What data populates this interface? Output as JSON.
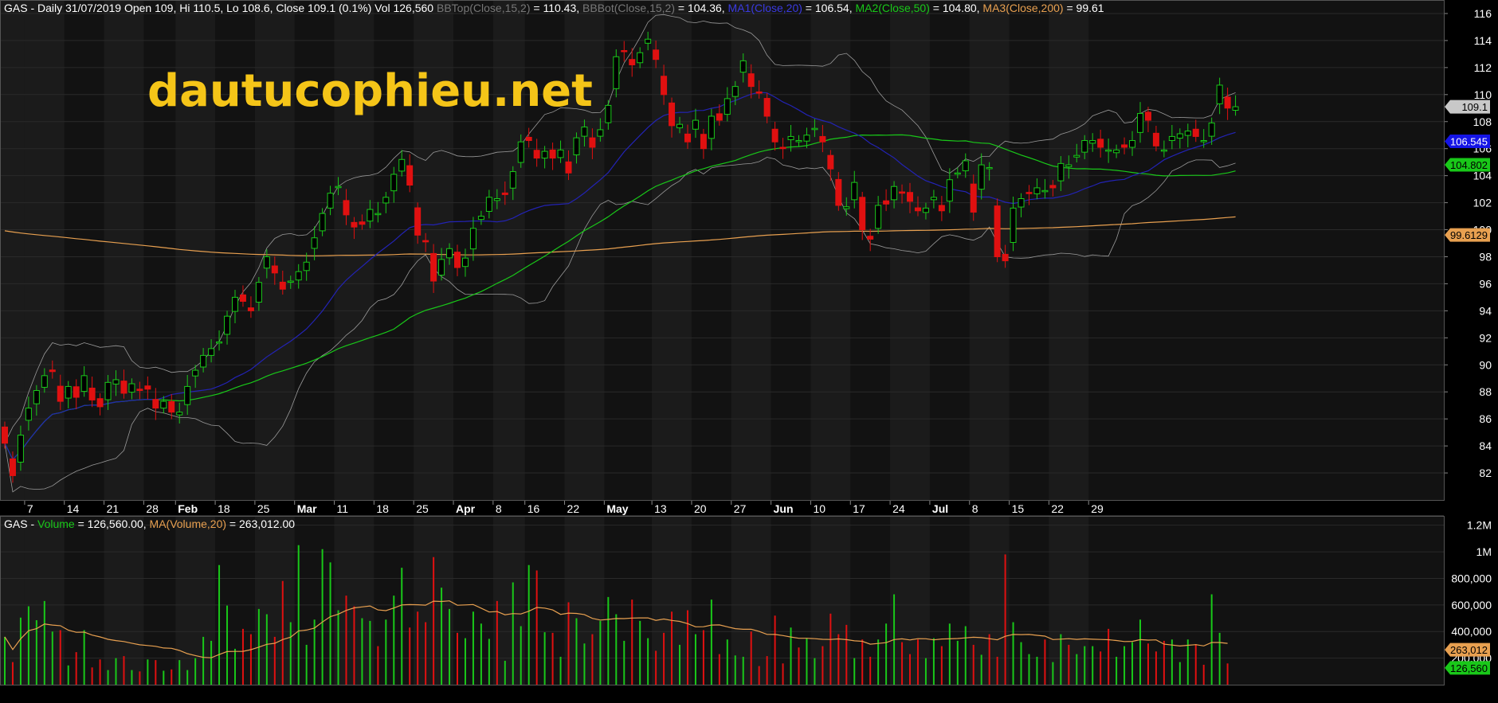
{
  "watermark": "dautucophieu.net",
  "colors": {
    "background": "#000000",
    "panel_even": "#1b1b1b",
    "panel_odd": "#121212",
    "grid": "#2a2a2a",
    "up": "#19c819",
    "down": "#e01010",
    "bb": "#9a9a9a",
    "ma20": "#2323b4",
    "ma50": "#19c819",
    "ma200": "#e8a050",
    "volma": "#e8a050",
    "text": "#ffffff",
    "label_gray": "#777777"
  },
  "price_legend": [
    {
      "text": "GAS - Daily 31/07/2019 Open 109, Hi 110.5, Lo 108.6, Close 109.1 (0.1%) Vol 126,560 ",
      "color": "#ffffff"
    },
    {
      "text": "BBTop(Close,15,2)",
      "color": "#777777"
    },
    {
      "text": " = 110.43, ",
      "color": "#ffffff"
    },
    {
      "text": "BBBot(Close,15,2)",
      "color": "#777777"
    },
    {
      "text": " = 104.36, ",
      "color": "#ffffff"
    },
    {
      "text": "MA1(Close,20)",
      "color": "#3a3ae0"
    },
    {
      "text": " = 106.54, ",
      "color": "#ffffff"
    },
    {
      "text": "MA2(Close,50)",
      "color": "#19c819"
    },
    {
      "text": " = 104.80, ",
      "color": "#ffffff"
    },
    {
      "text": "MA3(Close,200)",
      "color": "#e8a050"
    },
    {
      "text": " = 99.61",
      "color": "#ffffff"
    }
  ],
  "volume_legend": [
    {
      "text": "GAS - ",
      "color": "#ffffff"
    },
    {
      "text": "Volume",
      "color": "#19c819"
    },
    {
      "text": " = 126,560.00, ",
      "color": "#ffffff"
    },
    {
      "text": "MA(Volume,20)",
      "color": "#e8a050"
    },
    {
      "text": " = 263,012.00",
      "color": "#ffffff"
    }
  ],
  "price_tags": [
    {
      "text": "109.1",
      "value": 109.1,
      "bg": "#c8c8c8",
      "fg": "#000000"
    },
    {
      "text": "106.545",
      "value": 106.545,
      "bg": "#1414e6",
      "fg": "#ffffff"
    },
    {
      "text": "104.802",
      "value": 104.802,
      "bg": "#19c819",
      "fg": "#000000"
    },
    {
      "text": "99.6129",
      "value": 99.6129,
      "bg": "#e8a050",
      "fg": "#000000"
    }
  ],
  "volume_tags": [
    {
      "text": "263,012",
      "value": 263012,
      "bg": "#e8a050",
      "fg": "#000000"
    },
    {
      "text": "126,560",
      "value": 126560,
      "bg": "#19c819",
      "fg": "#000000"
    }
  ],
  "chart_data": [
    {
      "type": "candlestick",
      "title": "GAS - Daily 31/07/2019",
      "ylim": [
        80,
        117
      ],
      "yticks": [
        82,
        84,
        86,
        88,
        90,
        92,
        94,
        96,
        98,
        100,
        102,
        104,
        106,
        108,
        110,
        112,
        114,
        116
      ],
      "grid": true,
      "x_labels": [
        {
          "i": 3,
          "text": "7",
          "month": false
        },
        {
          "i": 8,
          "text": "14",
          "month": false
        },
        {
          "i": 13,
          "text": "21",
          "month": false
        },
        {
          "i": 18,
          "text": "28",
          "month": false
        },
        {
          "i": 22,
          "text": "Feb",
          "month": true
        },
        {
          "i": 27,
          "text": "18",
          "month": false
        },
        {
          "i": 32,
          "text": "25",
          "month": false
        },
        {
          "i": 37,
          "text": "Mar",
          "month": true
        },
        {
          "i": 42,
          "text": "11",
          "month": false
        },
        {
          "i": 47,
          "text": "18",
          "month": false
        },
        {
          "i": 52,
          "text": "25",
          "month": false
        },
        {
          "i": 57,
          "text": "Apr",
          "month": true
        },
        {
          "i": 62,
          "text": "8",
          "month": false
        },
        {
          "i": 66,
          "text": "16",
          "month": false
        },
        {
          "i": 71,
          "text": "22",
          "month": false
        },
        {
          "i": 76,
          "text": "May",
          "month": true
        },
        {
          "i": 82,
          "text": "13",
          "month": false
        },
        {
          "i": 87,
          "text": "20",
          "month": false
        },
        {
          "i": 92,
          "text": "27",
          "month": false
        },
        {
          "i": 97,
          "text": "Jun",
          "month": true
        },
        {
          "i": 102,
          "text": "10",
          "month": false
        },
        {
          "i": 107,
          "text": "17",
          "month": false
        },
        {
          "i": 112,
          "text": "24",
          "month": false
        },
        {
          "i": 117,
          "text": "Jul",
          "month": true
        },
        {
          "i": 122,
          "text": "8",
          "month": false
        },
        {
          "i": 127,
          "text": "15",
          "month": false
        },
        {
          "i": 132,
          "text": "22",
          "month": false
        },
        {
          "i": 137,
          "text": "29",
          "month": false
        }
      ],
      "close": [
        84.2,
        81.8,
        84.8,
        86.8,
        88.1,
        89.2,
        89.5,
        87.3,
        88.4,
        87.6,
        89.2,
        87.4,
        86.9,
        88.7,
        88.9,
        87.9,
        88.6,
        88.1,
        88.2,
        86.8,
        87.3,
        86.5,
        86.5,
        88.4,
        89.6,
        90.7,
        91.2,
        91.7,
        93.6,
        95.0,
        94.7,
        94.0,
        96.1,
        98.0,
        96.8,
        95.6,
        96.2,
        96.9,
        97.6,
        99.4,
        101.2,
        102.7,
        103.2,
        101.1,
        100.2,
        100.4,
        101.5,
        101.2,
        102.4,
        104.1,
        105.2,
        103.3,
        99.6,
        99.1,
        96.2,
        97.8,
        98.6,
        97.2,
        97.9,
        100.1,
        101.0,
        102.4,
        102.3,
        102.6,
        104.3,
        106.5,
        106.6,
        105.3,
        105.8,
        105.3,
        105.9,
        104.2,
        106.8,
        107.6,
        106.1,
        107.4,
        109.2,
        112.8,
        113.2,
        112.2,
        113.1,
        114.1,
        112.6,
        110.0,
        107.7,
        107.8,
        106.5,
        108.1,
        106.0,
        108.4,
        108.1,
        109.7,
        110.6,
        112.5,
        110.6,
        110.1,
        108.4,
        106.5,
        106.0,
        106.9,
        106.6,
        107.0,
        107.5,
        106.5,
        104.5,
        101.8,
        101.7,
        103.5,
        100.0,
        99.3,
        101.8,
        101.9,
        103.2,
        102.7,
        102.1,
        101.4,
        101.6,
        102.4,
        101.4,
        103.7,
        104.2,
        105.1,
        101.3,
        104.8,
        104.6,
        98.0,
        97.7,
        101.6,
        102.3,
        102.7,
        103.1,
        102.9,
        103.1,
        104.9,
        104.8,
        105.5,
        106.6,
        106.6,
        106.1,
        105.9,
        105.9,
        106.1,
        106.6,
        108.6,
        108.1,
        106.2,
        105.9,
        106.9,
        107.1,
        107.3,
        106.9,
        106.6,
        107.9,
        110.7,
        109.0,
        109.1
      ]
    },
    {
      "type": "bar",
      "title": "GAS - Volume",
      "ylim": [
        0,
        1270000
      ],
      "yticks": [
        {
          "value": 200000,
          "text": "200,000"
        },
        {
          "value": 400000,
          "text": "400,000"
        },
        {
          "value": 600000,
          "text": "600,000"
        },
        {
          "value": 800000,
          "text": "800,000"
        },
        {
          "value": 1000000,
          "text": "1M"
        },
        {
          "value": 1200000,
          "text": "1.2M"
        }
      ],
      "series": [
        {
          "name": "Volume",
          "values": [
            360000,
            170000,
            505000,
            590000,
            485000,
            630000,
            400000,
            410000,
            145000,
            245000,
            410000,
            130000,
            190000,
            110000,
            200000,
            215000,
            110000,
            100000,
            190000,
            185000,
            105000,
            115000,
            185000,
            110000,
            200000,
            360000,
            330000,
            900000,
            595000,
            270000,
            420000,
            380000,
            570000,
            530000,
            360000,
            780000,
            470000,
            1050000,
            300000,
            490000,
            1020000,
            920000,
            560000,
            670000,
            590000,
            500000,
            480000,
            290000,
            490000,
            670000,
            880000,
            430000,
            550000,
            470000,
            960000,
            730000,
            570000,
            390000,
            350000,
            550000,
            460000,
            345000,
            630000,
            180000,
            770000,
            440000,
            900000,
            860000,
            395000,
            390000,
            210000,
            620000,
            500000,
            310000,
            380000,
            480000,
            660000,
            530000,
            330000,
            640000,
            480000,
            350000,
            255000,
            390000,
            550000,
            300000,
            560000,
            380000,
            410000,
            640000,
            230000,
            340000,
            220000,
            210000,
            400000,
            140000,
            215000,
            520000,
            160000,
            430000,
            280000,
            350000,
            200000,
            290000,
            535000,
            380000,
            450000,
            200000,
            340000,
            210000,
            340000,
            460000,
            680000,
            320000,
            230000,
            340000,
            200000,
            350000,
            290000,
            460000,
            330000,
            440000,
            300000,
            225000,
            380000,
            210000,
            980000,
            470000,
            320000,
            230000,
            210000,
            340000,
            170000,
            380000,
            300000,
            230000,
            290000,
            290000,
            250000,
            420000,
            210000,
            290000,
            320000,
            490000,
            310000,
            250000,
            330000,
            340000,
            170000,
            340000,
            305000,
            150000,
            680000,
            390000,
            160000
          ]
        },
        {
          "name": "MA(Volume,20)",
          "values": [
            263012
          ]
        }
      ]
    }
  ]
}
